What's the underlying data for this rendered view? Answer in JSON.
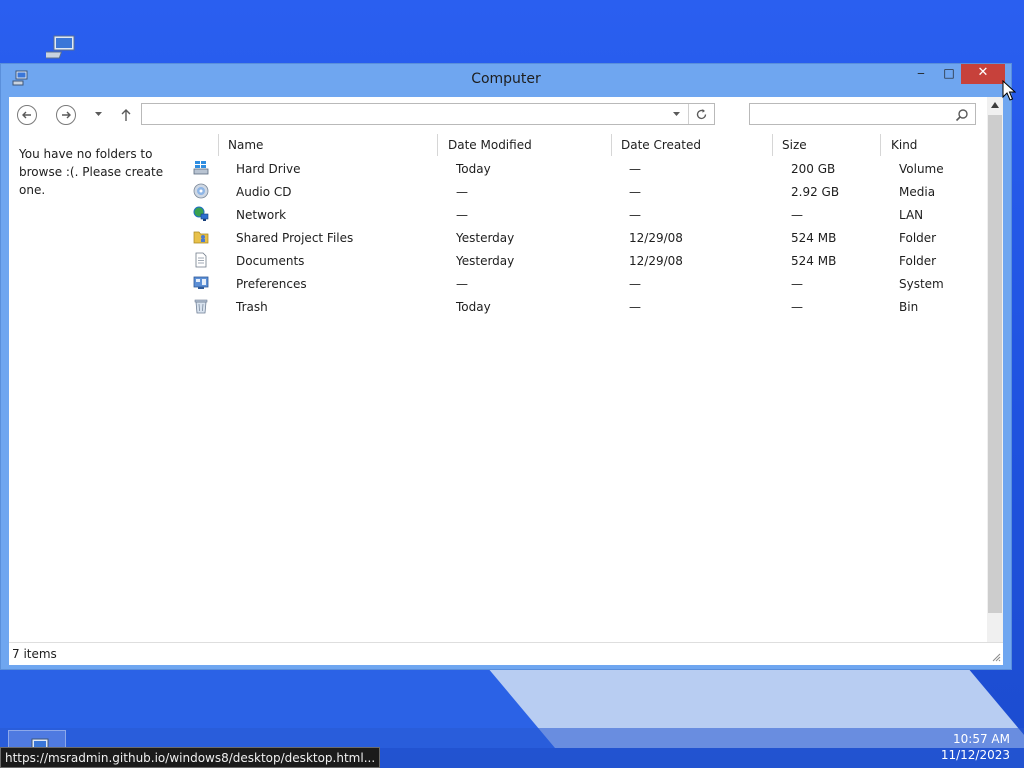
{
  "window": {
    "title": "Computer",
    "minimize_glyph": "‒",
    "maximize_glyph": "□",
    "close_glyph": "✕"
  },
  "toolbar": {
    "address_value": "",
    "search_value": ""
  },
  "sidebar": {
    "message": "You have no folders to browse :(. Please create one."
  },
  "columns": [
    "Name",
    "Date Modified",
    "Date Created",
    "Size",
    "Kind"
  ],
  "rows": [
    {
      "icon": "hard-drive-icon",
      "name": "Hard Drive",
      "modified": "Today",
      "created": "—",
      "size": "200 GB",
      "kind": "Volume"
    },
    {
      "icon": "audio-cd-icon",
      "name": "Audio CD",
      "modified": "—",
      "created": "—",
      "size": "2.92 GB",
      "kind": "Media"
    },
    {
      "icon": "network-icon",
      "name": "Network",
      "modified": "—",
      "created": "—",
      "size": "—",
      "kind": "LAN"
    },
    {
      "icon": "shared-folder-icon",
      "name": "Shared Project Files",
      "modified": "Yesterday",
      "created": "12/29/08",
      "size": "524 MB",
      "kind": "Folder"
    },
    {
      "icon": "documents-icon",
      "name": "Documents",
      "modified": "Yesterday",
      "created": "12/29/08",
      "size": "524 MB",
      "kind": "Folder"
    },
    {
      "icon": "preferences-icon",
      "name": "Preferences",
      "modified": "—",
      "created": "—",
      "size": "—",
      "kind": "System"
    },
    {
      "icon": "trash-icon",
      "name": "Trash",
      "modified": "Today",
      "created": "—",
      "size": "—",
      "kind": "Bin"
    }
  ],
  "status": {
    "item_count": "7 items"
  },
  "taskbar": {
    "time": "10:57 AM",
    "date": "11/12/2023"
  },
  "browser_status_url": "https://msradmin.github.io/windows8/desktop/desktop.html...",
  "colors": {
    "close_button": "#c7413b",
    "window_frame": "#6fa6f0",
    "desktop": "#1f52df"
  }
}
